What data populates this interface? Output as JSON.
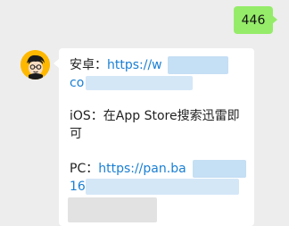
{
  "sent": {
    "text": "446"
  },
  "received": {
    "android_label": "安卓：",
    "android_link": "https://w",
    "android_link_cont": "co",
    "ios_line1": "iOS：在App Store搜索迅雷即",
    "ios_line2": "可",
    "pc_label": "PC：",
    "pc_link": "https://pan.ba",
    "pc_link_cont": "16"
  },
  "colors": {
    "sent_bubble": "#95ec69",
    "received_bubble": "#ffffff",
    "link": "#1a7fd4",
    "background": "#ededed",
    "avatar_bg": "#ffb800"
  },
  "icons": {
    "avatar": "cartoon-avatar"
  }
}
